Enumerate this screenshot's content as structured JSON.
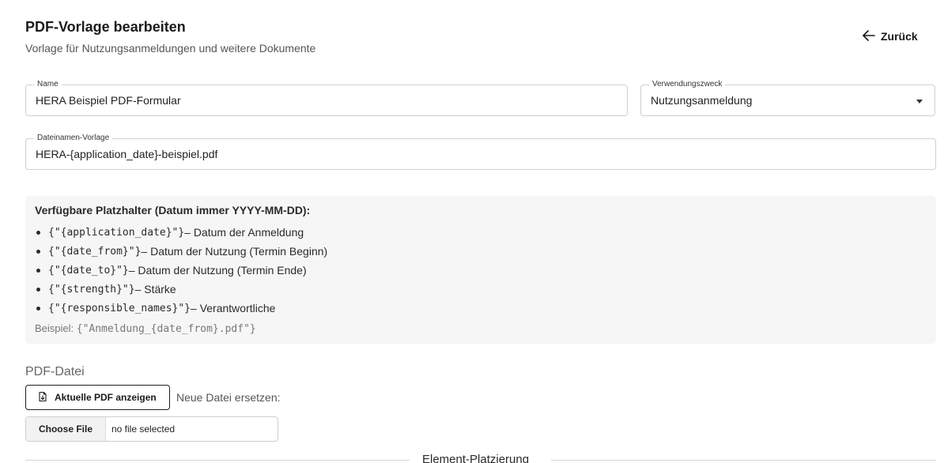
{
  "header": {
    "title": "PDF-Vorlage bearbeiten",
    "subtitle": "Vorlage für Nutzungsanmeldungen und weitere Dokumente",
    "back_label": "Zurück"
  },
  "form": {
    "name": {
      "label": "Name",
      "value": "HERA Beispiel PDF-Formular"
    },
    "purpose": {
      "label": "Verwendungszweck",
      "value": "Nutzungsanmeldung"
    },
    "filename_template": {
      "label": "Dateinamen-Vorlage",
      "value": "HERA-{application_date}-beispiel.pdf"
    }
  },
  "placeholders": {
    "title": "Verfügbare Platzhalter (Datum immer YYYY-MM-DD):",
    "items": [
      {
        "code": "{\"{application_date}\"}",
        "desc": " – Datum der Anmeldung"
      },
      {
        "code": "{\"{date_from}\"}",
        "desc": " – Datum der Nutzung (Termin Beginn)"
      },
      {
        "code": "{\"{date_to}\"}",
        "desc": " – Datum der Nutzung (Termin Ende)"
      },
      {
        "code": "{\"{strength}\"}",
        "desc": " – Stärke"
      },
      {
        "code": "{\"{responsible_names}\"}",
        "desc": " – Verantwortliche"
      }
    ],
    "example_label": "Beispiel: ",
    "example_code": "{\"Anmeldung_{date_from}.pdf\"}"
  },
  "pdf_section": {
    "label": "PDF-Datei",
    "show_button": "Aktuelle PDF anzeigen",
    "replace_label": "Neue Datei ersetzen:",
    "choose_file": "Choose File",
    "no_file": "no file selected"
  },
  "placement_section": {
    "label": "Element-Platzierung"
  }
}
